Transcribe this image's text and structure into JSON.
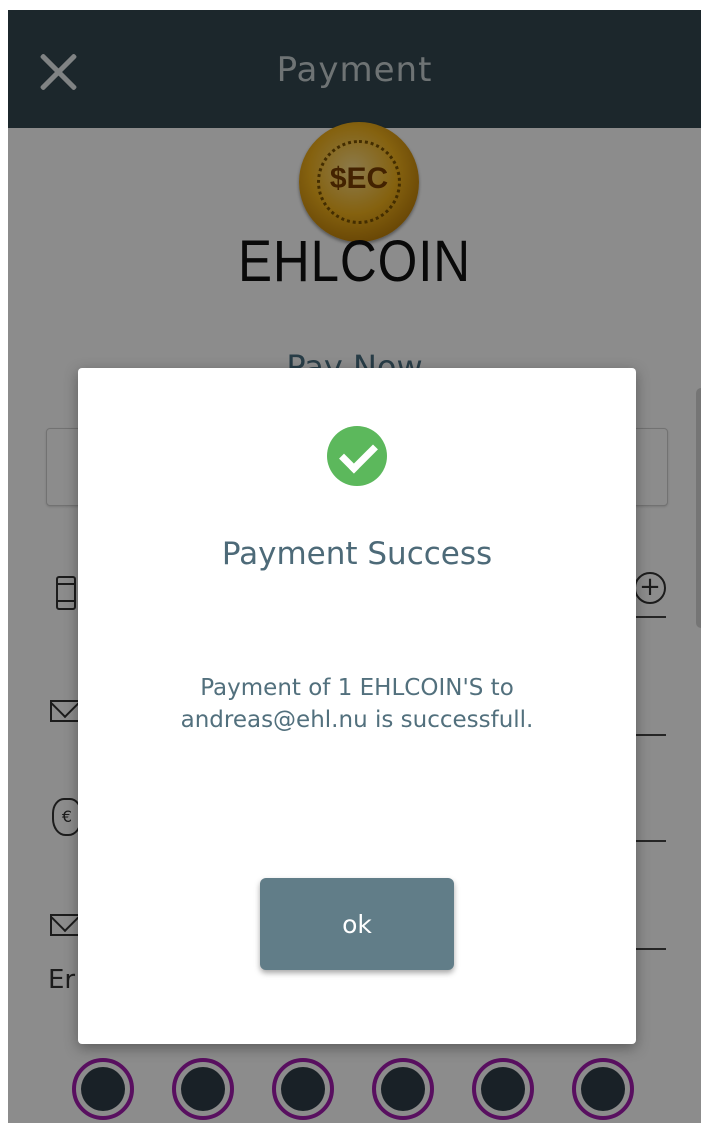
{
  "header": {
    "title": "Payment",
    "close_icon": "close-icon"
  },
  "page": {
    "coin_text": "$EC",
    "brand": "EHLCOIN",
    "pay_now": "Pay Now",
    "enter_label": "Er",
    "pin_count": 6
  },
  "dialog": {
    "icon": "check-circle-icon",
    "title": "Payment Success",
    "message_line1": "Payment of 1 EHLCOIN'S to",
    "message_line2": "andreas@ehl.nu is successfull.",
    "ok_label": "ok"
  },
  "colors": {
    "header_bg": "#334750",
    "success_green": "#5cb85c",
    "button_bg": "#617d88",
    "pin_ring": "#a21caf"
  }
}
